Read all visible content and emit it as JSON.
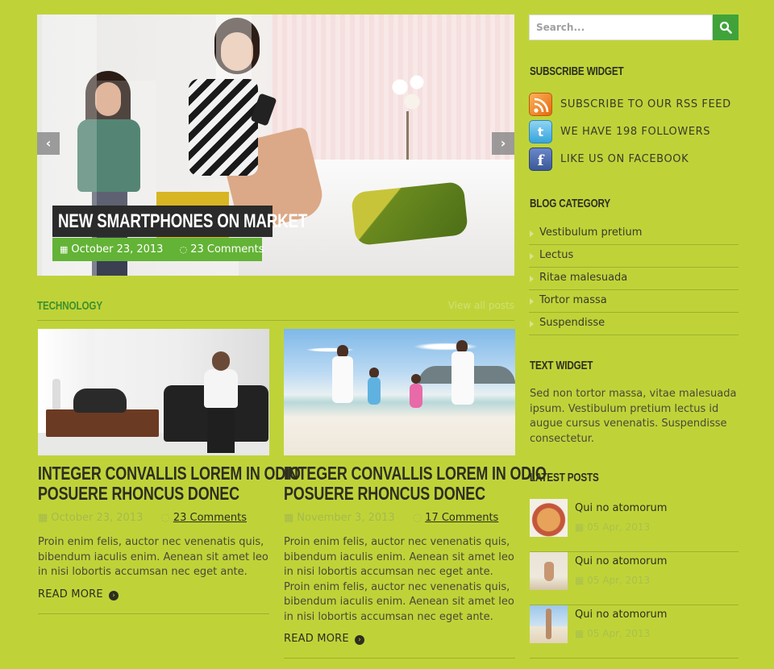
{
  "slider": {
    "caption": "NEW SMARTPHONES ON MARKET",
    "date": "October 23, 2013",
    "comments": "23 Comments",
    "prev_label": "‹",
    "next_label": "›"
  },
  "section": {
    "title": "TECHNOLOGY",
    "view_all": "View all posts"
  },
  "posts": [
    {
      "title_line1": "INTEGER CONVALLIS LOREM IN ODIO",
      "title_line2": "POSUERE RHONCUS DONEC",
      "date": "October 23, 2013",
      "comments": "23 Comments",
      "excerpt": "Proin enim felis, auctor nec venenatis quis, bibendum iaculis enim. Aenean sit amet leo in nisi lobortis accumsan nec eget ante.",
      "read_more": "READ MORE"
    },
    {
      "title_line1": "INTEGER CONVALLIS LOREM IN ODIO",
      "title_line2": "POSUERE RHONCUS DONEC",
      "date": "November 3, 2013",
      "comments": "17 Comments",
      "excerpt": "Proin enim felis, auctor nec venenatis quis, bibendum iaculis enim. Aenean sit amet leo in nisi lobortis accumsan nec eget ante. Proin enim felis, auctor nec venenatis quis, bibendum iaculis enim. Aenean sit amet leo in nisi lobortis accumsan nec eget ante.",
      "read_more": "READ MORE"
    }
  ],
  "sidebar": {
    "search_placeholder": "Search...",
    "subscribe": {
      "title": "SUBSCRIBE WIDGET",
      "items": [
        {
          "icon": "rss-icon",
          "label": "SUBSCRIBE TO OUR RSS FEED"
        },
        {
          "icon": "twitter-icon",
          "label": "WE HAVE 198 FOLLOWERS"
        },
        {
          "icon": "facebook-icon",
          "label": "LIKE US ON FACEBOOK"
        }
      ]
    },
    "category": {
      "title": "BLOG CATEGORY",
      "items": [
        "Vestibulum pretium",
        "Lectus",
        "Ritae malesuada",
        "Tortor massa",
        "Suspendisse"
      ]
    },
    "text_widget": {
      "title": "TEXT WIDGET",
      "body": "Sed non tortor massa, vitae malesuada ipsum. Vestibulum pretium lectus id augue cursus venenatis. Suspendisse consectetur."
    },
    "latest": {
      "title": "LATEST POSTS",
      "items": [
        {
          "title": "Qui no atomorum",
          "date": "05 Apr, 2013"
        },
        {
          "title": "Qui no atomorum",
          "date": "05 Apr, 2013"
        },
        {
          "title": "Qui no atomorum",
          "date": "05 Apr, 2013"
        }
      ]
    }
  },
  "colors": {
    "background": "#bfd339",
    "accent_green": "#63b336",
    "search_button": "#3fa33a",
    "caption_bg": "#2b2b2b"
  }
}
